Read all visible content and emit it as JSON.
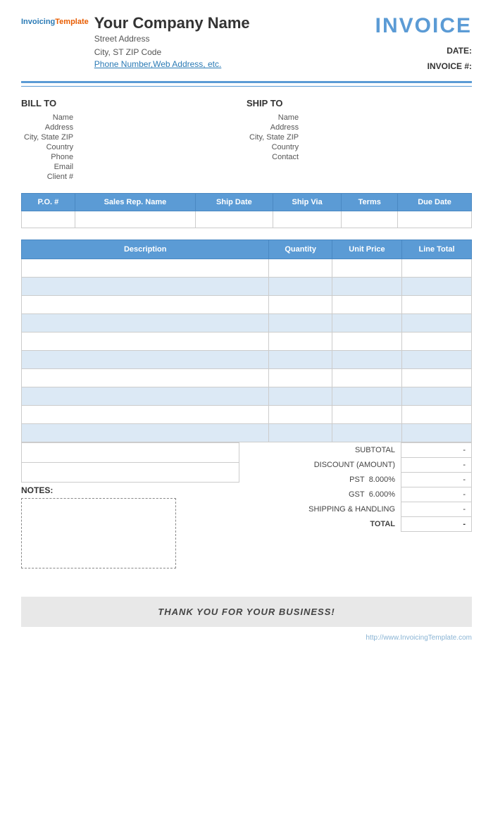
{
  "header": {
    "company_name": "Your Company Name",
    "street_address": "Street Address",
    "city_state_zip": "City, ST  ZIP Code",
    "phone_web": "Phone Number,Web Address, etc.",
    "invoice_title": "INVOICE",
    "date_label": "DATE:",
    "invoice_num_label": "INVOICE #:",
    "date_value": "",
    "invoice_num_value": ""
  },
  "bill_to": {
    "heading": "BILL TO",
    "name_label": "Name",
    "address_label": "Address",
    "city_state_zip_label": "City, State ZIP",
    "country_label": "Country",
    "phone_label": "Phone",
    "email_label": "Email",
    "client_label": "Client #"
  },
  "ship_to": {
    "heading": "SHIP TO",
    "name_label": "Name",
    "address_label": "Address",
    "city_state_zip_label": "City, State ZIP",
    "country_label": "Country",
    "contact_label": "Contact"
  },
  "po_table": {
    "headers": [
      "P.O. #",
      "Sales Rep. Name",
      "Ship Date",
      "Ship Via",
      "Terms",
      "Due Date"
    ]
  },
  "items_table": {
    "headers": {
      "description": "Description",
      "quantity": "Quantity",
      "unit_price": "Unit Price",
      "line_total": "Line Total"
    },
    "rows": [
      {
        "description": "",
        "quantity": "",
        "unit_price": "",
        "line_total": ""
      },
      {
        "description": "",
        "quantity": "",
        "unit_price": "",
        "line_total": ""
      },
      {
        "description": "",
        "quantity": "",
        "unit_price": "",
        "line_total": ""
      },
      {
        "description": "",
        "quantity": "",
        "unit_price": "",
        "line_total": ""
      },
      {
        "description": "",
        "quantity": "",
        "unit_price": "",
        "line_total": ""
      },
      {
        "description": "",
        "quantity": "",
        "unit_price": "",
        "line_total": ""
      },
      {
        "description": "",
        "quantity": "",
        "unit_price": "",
        "line_total": ""
      },
      {
        "description": "",
        "quantity": "",
        "unit_price": "",
        "line_total": ""
      },
      {
        "description": "",
        "quantity": "",
        "unit_price": "",
        "line_total": ""
      },
      {
        "description": "",
        "quantity": "",
        "unit_price": "",
        "line_total": ""
      }
    ]
  },
  "totals": {
    "subtotal_label": "SUBTOTAL",
    "subtotal_value": "-",
    "discount_label": "DISCOUNT (AMOUNT)",
    "discount_value": "-",
    "pst_label": "PST",
    "pst_rate": "8.000%",
    "pst_value": "-",
    "gst_label": "GST",
    "gst_rate": "6.000%",
    "gst_value": "-",
    "shipping_label": "SHIPPING & HANDLING",
    "shipping_value": "-",
    "total_label": "TOTAL",
    "total_value": "-"
  },
  "notes": {
    "label": "NOTES:"
  },
  "thank_you": {
    "message": "THANK YOU FOR YOUR BUSINESS!"
  },
  "footer": {
    "watermark": "http://www.InvoicingTemplate.com"
  },
  "logo": {
    "invoicing": "Invoicing",
    "template": "Template"
  }
}
